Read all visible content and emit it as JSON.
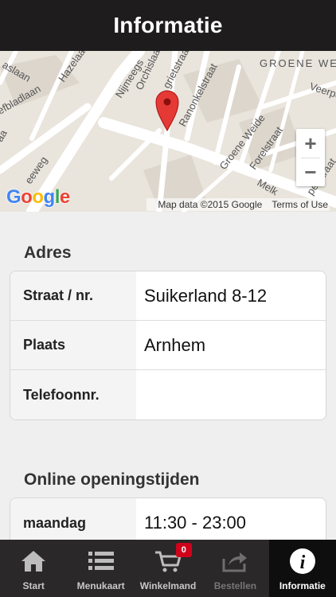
{
  "header": {
    "title": "Informatie"
  },
  "map": {
    "streets": [
      "GROENE WE",
      "Veerpo",
      "Hazelaa",
      "Orchislaan",
      "Nijmeegs",
      "grietstraat",
      "Ranonkelstraat",
      "efbladlaan",
      "aslaan",
      "Groene Weide",
      "Forelstraat",
      "Melk",
      "pe Straat",
      "eeweg",
      "aa"
    ],
    "logo": "Google",
    "attribution": "Map data ©2015 Google",
    "terms": "Terms of Use",
    "zoom_in": "+",
    "zoom_out": "−"
  },
  "address": {
    "title": "Adres",
    "rows": [
      {
        "label": "Straat / nr.",
        "value": "Suikerland 8-12"
      },
      {
        "label": "Plaats",
        "value": "Arnhem"
      },
      {
        "label": "Telefoonnr.",
        "value": ""
      }
    ]
  },
  "hours": {
    "title": "Online openingstijden",
    "rows": [
      {
        "label": "maandag",
        "value": "11:30 - 23:00"
      }
    ]
  },
  "tabbar": {
    "items": [
      {
        "label": "Start",
        "icon": "home-icon"
      },
      {
        "label": "Menukaart",
        "icon": "list-icon"
      },
      {
        "label": "Winkelmand",
        "icon": "cart-icon",
        "badge": "0"
      },
      {
        "label": "Bestellen",
        "icon": "share-icon"
      },
      {
        "label": "Informatie",
        "icon": "info-icon"
      }
    ]
  },
  "colors": {
    "header_bg": "#1e1c1c",
    "tabbar_bg": "#2a2828",
    "badge": "#d0021b",
    "marker": "#e53935"
  }
}
